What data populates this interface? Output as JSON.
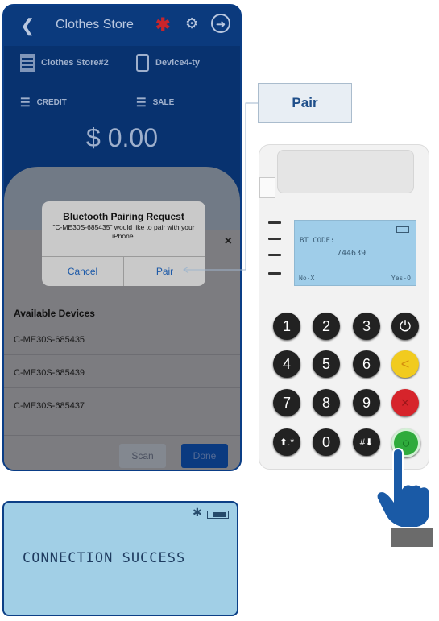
{
  "phone": {
    "title": "Clothes Store",
    "back_icon": "chevron-left-icon",
    "store_name": "Clothes Store#2",
    "device_name": "Device4-ty",
    "credit_label": "CREDIT",
    "sale_label": "SALE",
    "amount": "$ 0.00",
    "colors": {
      "header": "#0b3a7d",
      "bluetooth": "#c8242b"
    }
  },
  "dialog": {
    "title": "Bluetooth Pairing Request",
    "message": "\"C-ME30S-685435\" would like to pair with your iPhone.",
    "cancel_label": "Cancel",
    "pair_label": "Pair"
  },
  "sheet": {
    "close_label": "×",
    "heading": "Available Devices",
    "devices": [
      "C-ME30S-685435",
      "C-ME30S-685439",
      "C-ME30S-685437"
    ],
    "scan_label": "Scan",
    "done_label": "Done"
  },
  "callout": {
    "label": "Pair"
  },
  "reader": {
    "bt_label": "BT CODE:",
    "bt_code": "744639",
    "no_label": "No-X",
    "yes_label": "Yes-O",
    "keys": [
      "1",
      "2",
      "3",
      "⏻",
      "4",
      "5",
      "6",
      "<",
      "7",
      "8",
      "9",
      "×",
      "⬆.*",
      "0",
      "#⬇",
      "○"
    ]
  },
  "success": {
    "message": "CONNECTION SUCCESS",
    "bt_icon": "bluetooth-icon",
    "battery_icon": "battery-icon"
  }
}
